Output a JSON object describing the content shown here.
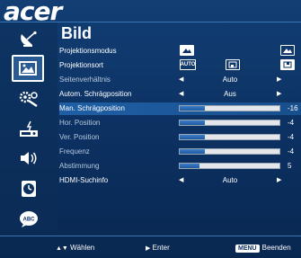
{
  "brand": {
    "logo": "acer"
  },
  "title": "Bild",
  "sidebar": {
    "items": [
      {
        "icon": "satellite-dish-icon"
      },
      {
        "icon": "picture-icon",
        "selected": true
      },
      {
        "icon": "settings-tools-icon"
      },
      {
        "icon": "projector-management-icon"
      },
      {
        "icon": "speaker-icon"
      },
      {
        "icon": "clock-icon"
      },
      {
        "icon": "language-abc-icon"
      }
    ]
  },
  "menu": {
    "projektionsmodus": {
      "label": "Projektionsmodus"
    },
    "projektionsort": {
      "label": "Projektionsort",
      "auto_label": "AUTO"
    },
    "seitenverhaeltnis": {
      "label": "Seitenverhältnis",
      "value": "Auto"
    },
    "autom_schraeg": {
      "label": "Autom. Schrägposition",
      "value": "Aus"
    },
    "man_schraeg": {
      "label": "Man. Schrägposition",
      "value": "-16",
      "level": 0.25
    },
    "hor_position": {
      "label": "Hor. Position",
      "value": "-4",
      "level": 0.25
    },
    "ver_position": {
      "label": "Ver. Position",
      "value": "-4",
      "level": 0.25
    },
    "frequenz": {
      "label": "Frequenz",
      "value": "-4",
      "level": 0.25
    },
    "abstimmung": {
      "label": "Abstimmung",
      "value": "5",
      "level": 0.2
    },
    "hdmi": {
      "label": "HDMI-Suchinfo",
      "value": "Auto"
    }
  },
  "footer": {
    "select": "Wählen",
    "enter": "Enter",
    "menu_key": "MENU",
    "exit": "Beenden"
  },
  "colors": {
    "background": "#0b2f5f",
    "highlight": "#1f5fa5",
    "slider_fill": "#2f6db5"
  }
}
